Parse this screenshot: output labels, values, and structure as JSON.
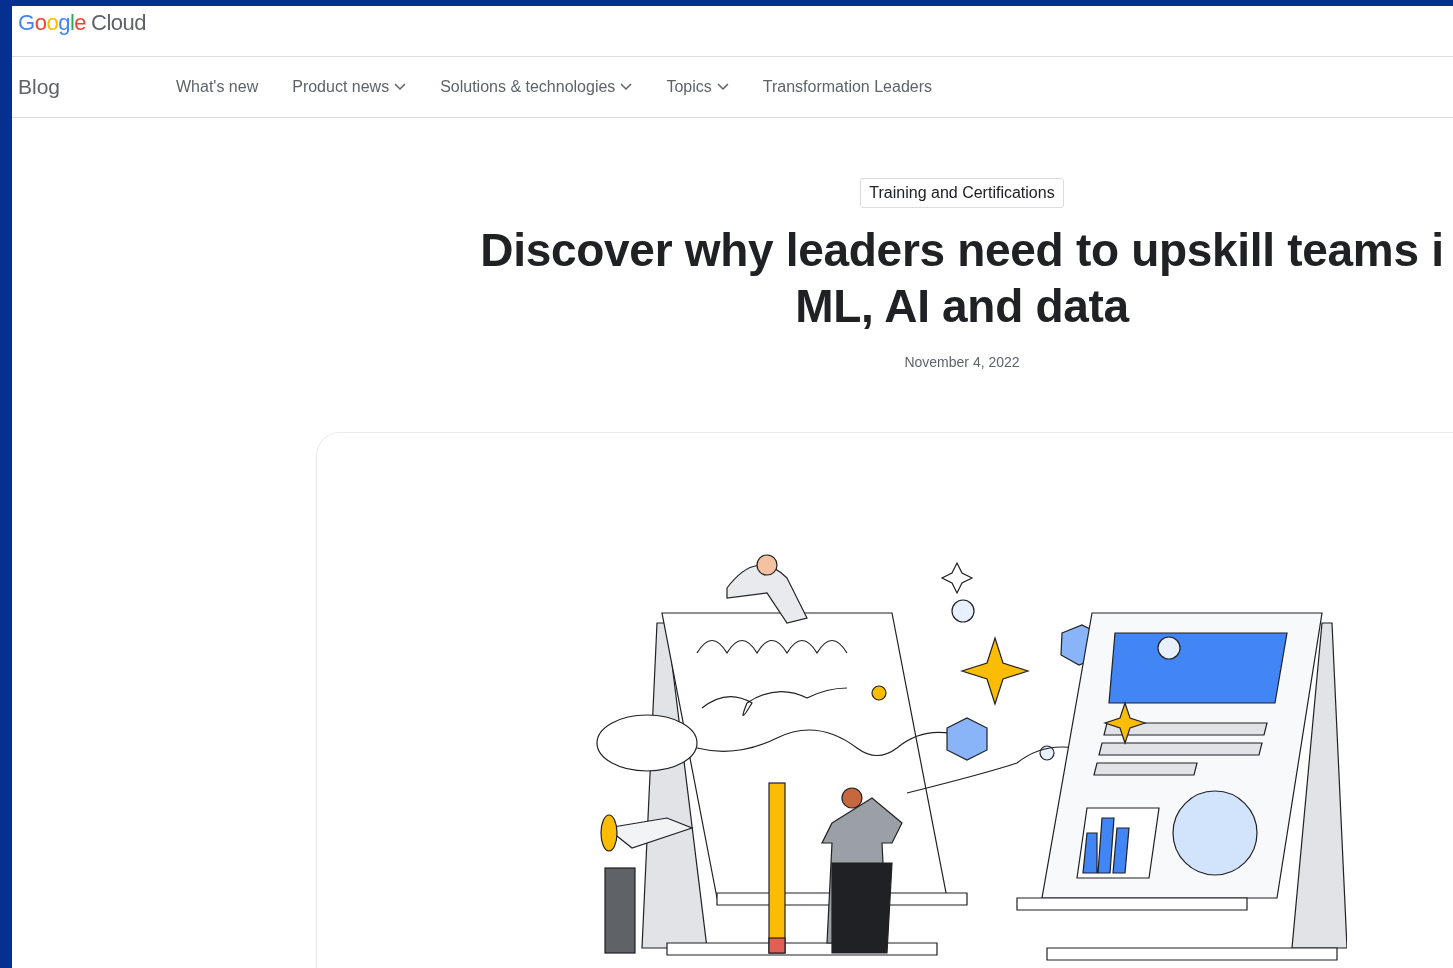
{
  "header": {
    "logo_word": "Google",
    "logo_product": "Cloud"
  },
  "nav": {
    "section": "Blog",
    "items": [
      {
        "label": "What's new",
        "dropdown": false
      },
      {
        "label": "Product news",
        "dropdown": true
      },
      {
        "label": "Solutions & technologies",
        "dropdown": true
      },
      {
        "label": "Topics",
        "dropdown": true
      },
      {
        "label": "Transformation Leaders",
        "dropdown": false
      }
    ]
  },
  "article": {
    "category": "Training and Certifications",
    "title_lines": [
      "Discover why leaders need to upskill teams i",
      "ML, AI and data"
    ],
    "date": "November 4, 2022"
  }
}
